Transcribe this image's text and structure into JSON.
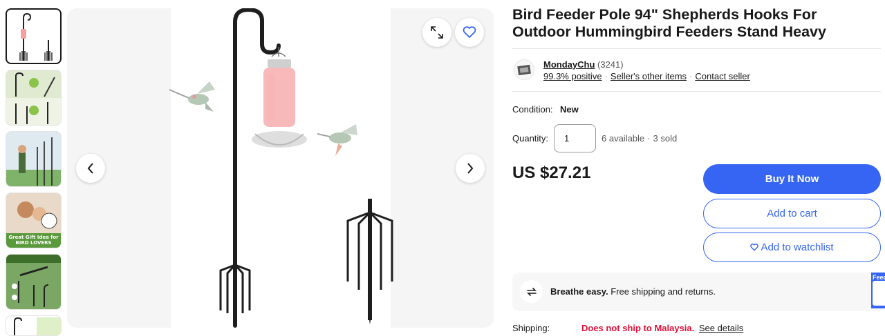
{
  "thumbnails": [
    {
      "caption": ""
    },
    {
      "caption": ""
    },
    {
      "caption": ""
    },
    {
      "caption": "Great Gift Idea for BIRD LOVERS"
    },
    {
      "caption": ""
    },
    {
      "caption": ""
    }
  ],
  "product": {
    "title": "Bird Feeder Pole 94\" Shepherds Hooks For Outdoor Hummingbird Feeders Stand Heavy",
    "condition_label": "Condition:",
    "condition_value": "New",
    "quantity_label": "Quantity:",
    "quantity_value": "1",
    "available": "6 available",
    "sold": "3 sold",
    "price": "US $27.21"
  },
  "seller": {
    "name": "MondayChu",
    "feedback_count": "(3241)",
    "positive": "99.3% positive",
    "other_items": "Seller's other items",
    "contact": "Contact seller"
  },
  "actions": {
    "buy_now": "Buy It Now",
    "add_to_cart": "Add to cart",
    "add_to_watchlist": "Add to watchlist"
  },
  "banner": {
    "bold": "Breathe easy.",
    "text": "Free shipping and returns.",
    "feedback_tab": "Feed"
  },
  "shipping": {
    "label": "Shipping:",
    "warning": "Does not ship to Malaysia.",
    "details_link": "See details"
  },
  "colors": {
    "accent": "#3665f3",
    "warning": "#e0103a",
    "text": "#191919"
  },
  "icons": [
    "expand-icon",
    "heart-icon",
    "chevron-left-icon",
    "chevron-right-icon",
    "seller-logo-icon",
    "returns-icon"
  ]
}
